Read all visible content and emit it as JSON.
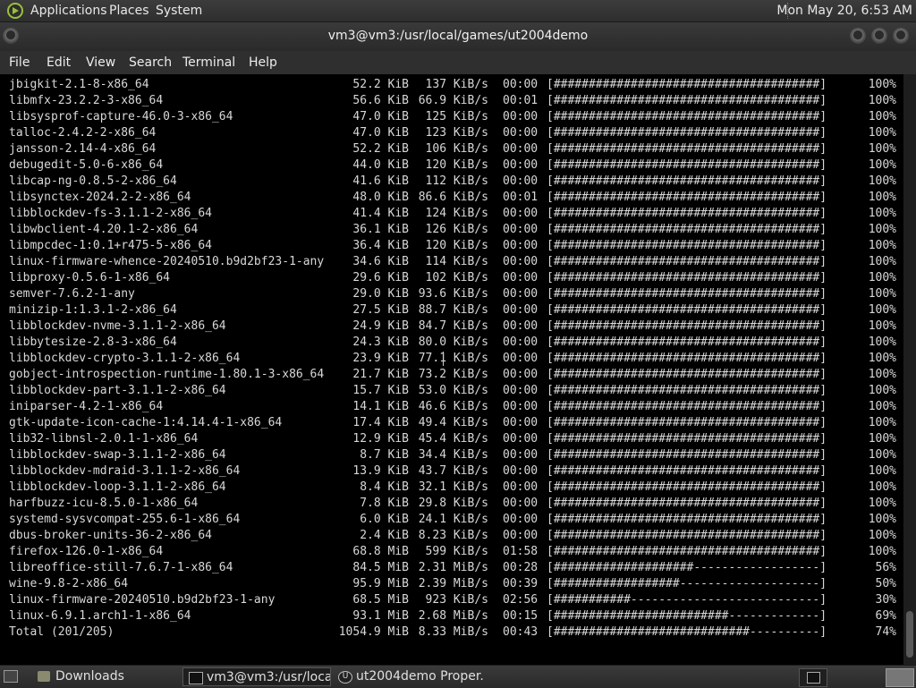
{
  "top_panel": {
    "menus": [
      "Applications",
      "Places",
      "System"
    ],
    "clock": "Mon May 20,  6:53 AM"
  },
  "window": {
    "title": "vm3@vm3:/usr/local/games/ut2004demo"
  },
  "menu_bar": [
    "File",
    "Edit",
    "View",
    "Search",
    "Terminal",
    "Help"
  ],
  "terminal": {
    "rows": [
      {
        "name": "jbigkit-2.1-8-x86_64",
        "size": "52.2 KiB",
        "rate": "137 KiB/s",
        "time": "00:00",
        "bar": "[######################################]",
        "pct": "100%"
      },
      {
        "name": "libmfx-23.2.2-3-x86_64",
        "size": "56.6 KiB",
        "rate": "66.9 KiB/s",
        "time": "00:01",
        "bar": "[######################################]",
        "pct": "100%"
      },
      {
        "name": "libsysprof-capture-46.0-3-x86_64",
        "size": "47.0 KiB",
        "rate": "125 KiB/s",
        "time": "00:00",
        "bar": "[######################################]",
        "pct": "100%"
      },
      {
        "name": "talloc-2.4.2-2-x86_64",
        "size": "47.0 KiB",
        "rate": "123 KiB/s",
        "time": "00:00",
        "bar": "[######################################]",
        "pct": "100%"
      },
      {
        "name": "jansson-2.14-4-x86_64",
        "size": "52.2 KiB",
        "rate": "106 KiB/s",
        "time": "00:00",
        "bar": "[######################################]",
        "pct": "100%"
      },
      {
        "name": "debugedit-5.0-6-x86_64",
        "size": "44.0 KiB",
        "rate": "120 KiB/s",
        "time": "00:00",
        "bar": "[######################################]",
        "pct": "100%"
      },
      {
        "name": "libcap-ng-0.8.5-2-x86_64",
        "size": "41.6 KiB",
        "rate": "112 KiB/s",
        "time": "00:00",
        "bar": "[######################################]",
        "pct": "100%"
      },
      {
        "name": "libsynctex-2024.2-2-x86_64",
        "size": "48.0 KiB",
        "rate": "86.6 KiB/s",
        "time": "00:01",
        "bar": "[######################################]",
        "pct": "100%"
      },
      {
        "name": "libblockdev-fs-3.1.1-2-x86_64",
        "size": "41.4 KiB",
        "rate": "124 KiB/s",
        "time": "00:00",
        "bar": "[######################################]",
        "pct": "100%"
      },
      {
        "name": "libwbclient-4.20.1-2-x86_64",
        "size": "36.1 KiB",
        "rate": "126 KiB/s",
        "time": "00:00",
        "bar": "[######################################]",
        "pct": "100%"
      },
      {
        "name": "libmpcdec-1:0.1+r475-5-x86_64",
        "size": "36.4 KiB",
        "rate": "120 KiB/s",
        "time": "00:00",
        "bar": "[######################################]",
        "pct": "100%"
      },
      {
        "name": "linux-firmware-whence-20240510.b9d2bf23-1-any",
        "size": "34.6 KiB",
        "rate": "114 KiB/s",
        "time": "00:00",
        "bar": "[######################################]",
        "pct": "100%"
      },
      {
        "name": "libproxy-0.5.6-1-x86_64",
        "size": "29.6 KiB",
        "rate": "102 KiB/s",
        "time": "00:00",
        "bar": "[######################################]",
        "pct": "100%"
      },
      {
        "name": "semver-7.6.2-1-any",
        "size": "29.0 KiB",
        "rate": "93.6 KiB/s",
        "time": "00:00",
        "bar": "[######################################]",
        "pct": "100%"
      },
      {
        "name": "minizip-1:1.3.1-2-x86_64",
        "size": "27.5 KiB",
        "rate": "88.7 KiB/s",
        "time": "00:00",
        "bar": "[######################################]",
        "pct": "100%"
      },
      {
        "name": "libblockdev-nvme-3.1.1-2-x86_64",
        "size": "24.9 KiB",
        "rate": "84.7 KiB/s",
        "time": "00:00",
        "bar": "[######################################]",
        "pct": "100%"
      },
      {
        "name": "libbytesize-2.8-3-x86_64",
        "size": "24.3 KiB",
        "rate": "80.0 KiB/s",
        "time": "00:00",
        "bar": "[######################################]",
        "pct": "100%"
      },
      {
        "name": "libblockdev-crypto-3.1.1-2-x86_64",
        "size": "23.9 KiB",
        "rate": "77.1 KiB/s",
        "time": "00:00",
        "bar": "[######################################]",
        "pct": "100%"
      },
      {
        "name": "gobject-introspection-runtime-1.80.1-3-x86_64",
        "size": "21.7 KiB",
        "rate": "73.2 KiB/s",
        "time": "00:00",
        "bar": "[######################################]",
        "pct": "100%"
      },
      {
        "name": "libblockdev-part-3.1.1-2-x86_64",
        "size": "15.7 KiB",
        "rate": "53.0 KiB/s",
        "time": "00:00",
        "bar": "[######################################]",
        "pct": "100%"
      },
      {
        "name": "iniparser-4.2-1-x86_64",
        "size": "14.1 KiB",
        "rate": "46.6 KiB/s",
        "time": "00:00",
        "bar": "[######################################]",
        "pct": "100%"
      },
      {
        "name": "gtk-update-icon-cache-1:4.14.4-1-x86_64",
        "size": "17.4 KiB",
        "rate": "49.4 KiB/s",
        "time": "00:00",
        "bar": "[######################################]",
        "pct": "100%"
      },
      {
        "name": "lib32-libnsl-2.0.1-1-x86_64",
        "size": "12.9 KiB",
        "rate": "45.4 KiB/s",
        "time": "00:00",
        "bar": "[######################################]",
        "pct": "100%"
      },
      {
        "name": "libblockdev-swap-3.1.1-2-x86_64",
        "size": "8.7 KiB",
        "rate": "34.4 KiB/s",
        "time": "00:00",
        "bar": "[######################################]",
        "pct": "100%"
      },
      {
        "name": "libblockdev-mdraid-3.1.1-2-x86_64",
        "size": "13.9 KiB",
        "rate": "43.7 KiB/s",
        "time": "00:00",
        "bar": "[######################################]",
        "pct": "100%"
      },
      {
        "name": "libblockdev-loop-3.1.1-2-x86_64",
        "size": "8.4 KiB",
        "rate": "32.1 KiB/s",
        "time": "00:00",
        "bar": "[######################################]",
        "pct": "100%"
      },
      {
        "name": "harfbuzz-icu-8.5.0-1-x86_64",
        "size": "7.8 KiB",
        "rate": "29.8 KiB/s",
        "time": "00:00",
        "bar": "[######################################]",
        "pct": "100%"
      },
      {
        "name": "systemd-sysvcompat-255.6-1-x86_64",
        "size": "6.0 KiB",
        "rate": "24.1 KiB/s",
        "time": "00:00",
        "bar": "[######################################]",
        "pct": "100%"
      },
      {
        "name": "dbus-broker-units-36-2-x86_64",
        "size": "2.4 KiB",
        "rate": "8.23 KiB/s",
        "time": "00:00",
        "bar": "[######################################]",
        "pct": "100%"
      },
      {
        "name": "firefox-126.0-1-x86_64",
        "size": "68.8 MiB",
        "rate": "599 KiB/s",
        "time": "01:58",
        "bar": "[######################################]",
        "pct": "100%"
      },
      {
        "name": "libreoffice-still-7.6.7-1-x86_64",
        "size": "84.5 MiB",
        "rate": "2.31 MiB/s",
        "time": "00:28",
        "bar": "[####################------------------]",
        "pct": "56%"
      },
      {
        "name": "wine-9.8-2-x86_64",
        "size": "95.9 MiB",
        "rate": "2.39 MiB/s",
        "time": "00:39",
        "bar": "[##################--------------------]",
        "pct": "50%"
      },
      {
        "name": "linux-firmware-20240510.b9d2bf23-1-any",
        "size": "68.5 MiB",
        "rate": "923 KiB/s",
        "time": "02:56",
        "bar": "[###########---------------------------]",
        "pct": "30%"
      },
      {
        "name": "linux-6.9.1.arch1-1-x86_64",
        "size": "93.1 MiB",
        "rate": "2.68 MiB/s",
        "time": "00:15",
        "bar": "[#########################-------------]",
        "pct": "69%"
      },
      {
        "name": "Total (201/205)",
        "size": "1054.9 MiB",
        "rate": "8.33 MiB/s",
        "time": "00:43",
        "bar": "[############################----------]",
        "pct": "74%"
      }
    ]
  },
  "taskbar": {
    "tasks": [
      "Downloads",
      "vm3@vm3:/usr/loca...",
      "ut2004demo Proper..."
    ],
    "ut_icon_glyph": "U"
  },
  "colors": {
    "terminal_bg": "#000000",
    "terminal_fg": "#d8d8d8",
    "panel_bg": "#333333"
  },
  "icons": [
    "applications-logo-icon",
    "window-menu-icon",
    "minimize-icon",
    "maximize-icon",
    "close-icon",
    "show-desktop-icon",
    "folder-icon",
    "terminal-icon",
    "ut2004-icon",
    "workspace-switcher-icon"
  ]
}
